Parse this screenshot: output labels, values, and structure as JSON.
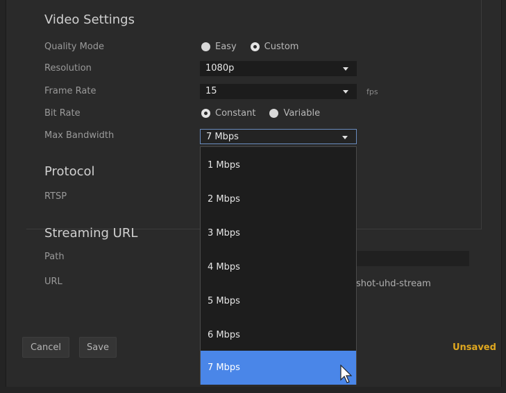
{
  "video_settings": {
    "title": "Video Settings",
    "quality_mode": {
      "label": "Quality Mode",
      "options": [
        "Easy",
        "Custom"
      ],
      "selected": "Custom"
    },
    "resolution": {
      "label": "Resolution",
      "value": "1080p"
    },
    "frame_rate": {
      "label": "Frame Rate",
      "value": "15",
      "unit": "fps"
    },
    "bit_rate": {
      "label": "Bit Rate",
      "options": [
        "Constant",
        "Variable"
      ],
      "selected": "Constant"
    },
    "max_bandwidth": {
      "label": "Max Bandwidth",
      "value": "7 Mbps",
      "options": [
        "1 Mbps",
        "2 Mbps",
        "3 Mbps",
        "4 Mbps",
        "5 Mbps",
        "6 Mbps",
        "7 Mbps"
      ],
      "selected": "7 Mbps"
    }
  },
  "protocol": {
    "title": "Protocol",
    "rtsp_label": "RTSP"
  },
  "streaming_url": {
    "title": "Streaming URL",
    "path_label": "Path",
    "url_label": "URL",
    "url_value_visible": "shot-uhd-stream"
  },
  "footer": {
    "cancel_label": "Cancel",
    "save_label": "Save",
    "status": "Unsaved"
  },
  "colors": {
    "accent_selected": "#4a86e8",
    "status_unsaved": "#e0a81f"
  },
  "icons": {
    "cursor": "mouse-pointer-icon",
    "dropdown_caret": "chevron-down-icon"
  }
}
